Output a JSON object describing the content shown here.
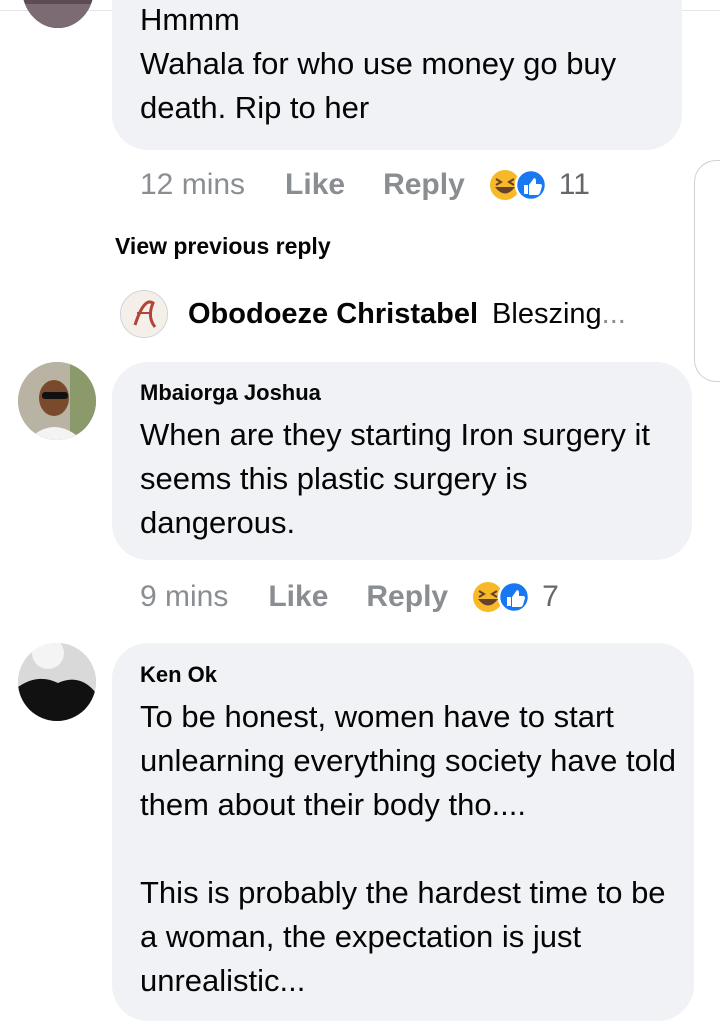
{
  "comments": [
    {
      "body": "Hmmm\nWahala for who use money go buy death. Rip to her",
      "time": "12 mins",
      "like_label": "Like",
      "reply_label": "Reply",
      "reaction_icons": [
        "haha-icon",
        "like-icon"
      ],
      "reaction_count": "11"
    },
    {
      "author": "Mbaiorga Joshua",
      "body": "When are they starting Iron surgery it seems this plastic surgery is dangerous.",
      "time": "9 mins",
      "like_label": "Like",
      "reply_label": "Reply",
      "reaction_icons": [
        "haha-icon",
        "like-icon"
      ],
      "reaction_count": "7"
    },
    {
      "author": "Ken Ok",
      "body": "To be honest, women have to start unlearning everything society have told them about their body tho....\n\nThis is probably the hardest time to be a woman, the expectation is just unrealistic..."
    }
  ],
  "view_previous_reply": "View previous reply",
  "reply_preview": {
    "author": "Obodoeze Christabel",
    "snippet": "Bleszing",
    "ellipsis": "..."
  },
  "colors": {
    "bubble": "#f0f2f5",
    "meta_text": "#8a8d91",
    "like_blue": "#1877f2",
    "haha_yellow": "#f7b928"
  }
}
